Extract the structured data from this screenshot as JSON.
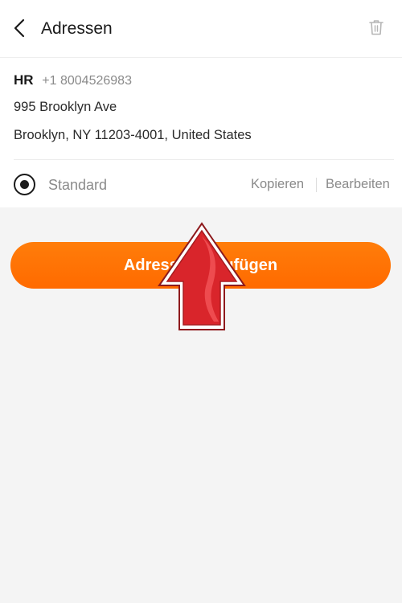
{
  "header": {
    "title": "Adressen",
    "back_icon": "chevron-left-icon",
    "delete_icon": "trash-icon"
  },
  "address": {
    "name": "HR",
    "phone": "+1 8004526983",
    "street": "995 Brooklyn Ave",
    "city_line": "Brooklyn, NY 11203-4001, United States"
  },
  "actions": {
    "default_label": "Standard",
    "default_selected": true,
    "copy_label": "Kopieren",
    "edit_label": "Bearbeiten"
  },
  "add_button": {
    "label": "Adresse hinzufügen"
  },
  "colors": {
    "accent": "#ff6e00",
    "overlay_arrow": "#d9252b"
  }
}
